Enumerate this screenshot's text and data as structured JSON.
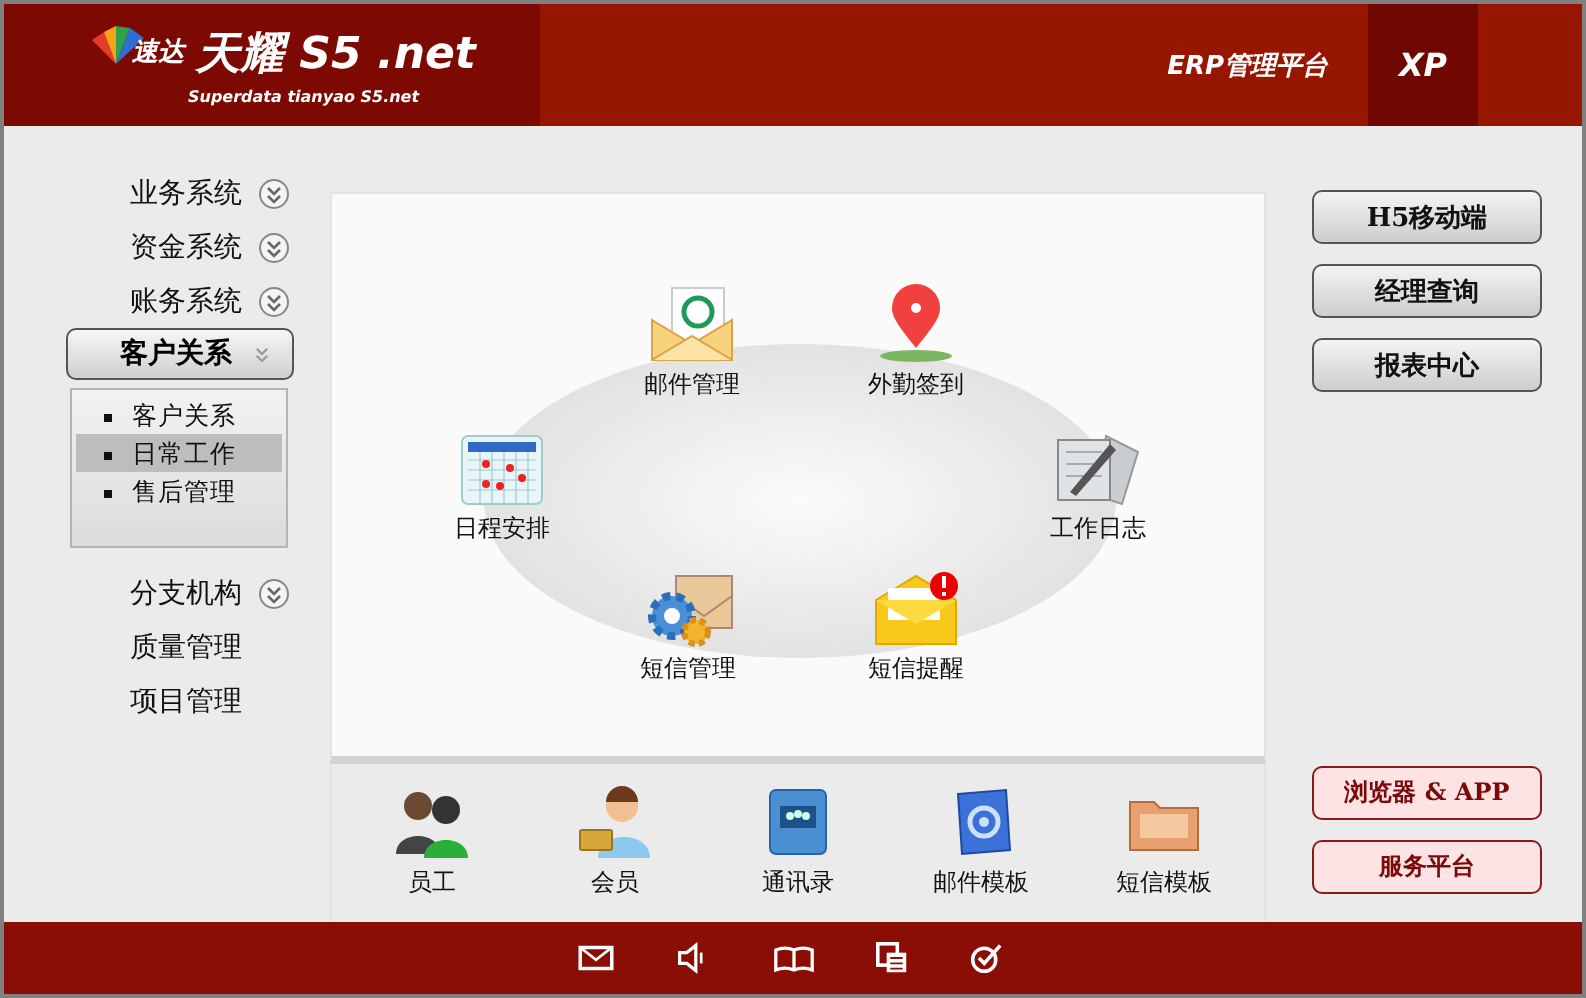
{
  "header": {
    "brand_mark": "速达",
    "brand_name": "天耀 S5 .net",
    "brand_sub": "Superdata tianyao S5.net",
    "platform": "ERP管理平台",
    "edition": "XP"
  },
  "sidebar": {
    "items": [
      {
        "label": "业务系统",
        "expandable": true,
        "expanded": false
      },
      {
        "label": "资金系统",
        "expandable": true,
        "expanded": false
      },
      {
        "label": "账务系统",
        "expandable": true,
        "expanded": false
      },
      {
        "label": "客户关系",
        "expandable": true,
        "expanded": true,
        "children": [
          {
            "label": "客户关系",
            "selected": false
          },
          {
            "label": "日常工作",
            "selected": true
          },
          {
            "label": "售后管理",
            "selected": false
          }
        ]
      },
      {
        "label": "分支机构",
        "expandable": true,
        "expanded": false
      },
      {
        "label": "质量管理",
        "expandable": false,
        "expanded": false
      },
      {
        "label": "项目管理",
        "expandable": false,
        "expanded": false
      }
    ]
  },
  "workflow": [
    {
      "label": "邮件管理",
      "kind": "mail"
    },
    {
      "label": "外勤签到",
      "kind": "location"
    },
    {
      "label": "日程安排",
      "kind": "calendar"
    },
    {
      "label": "工作日志",
      "kind": "journal"
    },
    {
      "label": "短信管理",
      "kind": "sms-settings"
    },
    {
      "label": "短信提醒",
      "kind": "sms-alert"
    }
  ],
  "shortcuts": [
    {
      "label": "员工",
      "kind": "staff"
    },
    {
      "label": "会员",
      "kind": "member"
    },
    {
      "label": "通讯录",
      "kind": "contacts"
    },
    {
      "label": "邮件模板",
      "kind": "mail-template"
    },
    {
      "label": "短信模板",
      "kind": "sms-template"
    }
  ],
  "right_buttons": [
    {
      "label": "H5移动端",
      "kind": "grey"
    },
    {
      "label": "经理查询",
      "kind": "grey"
    },
    {
      "label": "报表中心",
      "kind": "grey"
    },
    {
      "label": "浏览器 & APP",
      "kind": "red"
    },
    {
      "label": "服务平台",
      "kind": "red"
    }
  ]
}
